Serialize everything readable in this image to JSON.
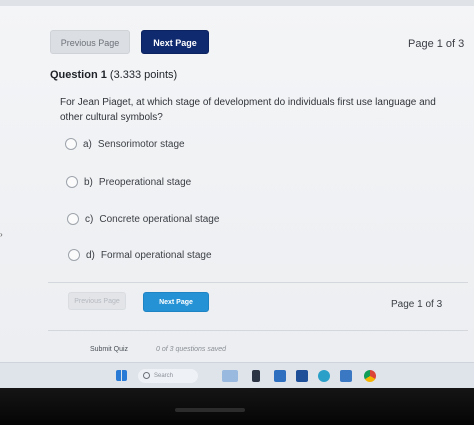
{
  "nav": {
    "previous_label": "Previous Page",
    "next_label": "Next Page",
    "page_indicator": "Page 1 of 3"
  },
  "question": {
    "title": "Question 1",
    "points": "(3.333 points)",
    "text": "For Jean Piaget, at which stage of development do individuals first use language and other cultural symbols?",
    "options": [
      {
        "letter": "a)",
        "text": "Sensorimotor stage"
      },
      {
        "letter": "b)",
        "text": "Preoperational stage"
      },
      {
        "letter": "c)",
        "text": "Concrete operational stage"
      },
      {
        "letter": "d)",
        "text": "Formal operational stage"
      }
    ]
  },
  "bottom_nav": {
    "previous_label": "Previous Page",
    "next_label": "Next Page",
    "page_indicator": "Page 1 of 3"
  },
  "footer": {
    "submit_label": "Submit Quiz",
    "saved_status": "0 of 3 questions saved"
  },
  "taskbar": {
    "search_placeholder": "Search",
    "icons": [
      "windows-start-icon",
      "search-icon",
      "widgets-icon",
      "file-explorer-icon",
      "store-icon",
      "edge-browser-icon",
      "settings-icon",
      "chrome-icon"
    ]
  },
  "colors": {
    "next_button": "#0f2a6e",
    "next_button_bottom": "#2592d6",
    "background": "#eceef1"
  }
}
